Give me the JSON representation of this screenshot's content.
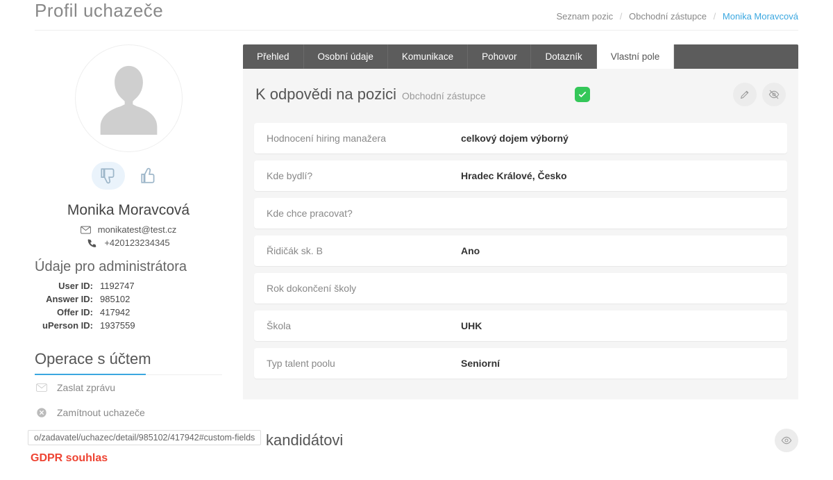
{
  "header": {
    "title": "Profil uchazeče"
  },
  "breadcrumb": {
    "items": [
      {
        "label": "Seznam pozic",
        "active": false
      },
      {
        "label": "Obchodní zástupce",
        "active": false
      },
      {
        "label": "Monika Moravcová",
        "active": true
      }
    ]
  },
  "candidate": {
    "name": "Monika Moravcová",
    "email": "monikatest@test.cz",
    "phone": "+420123234345"
  },
  "admin": {
    "heading": "Údaje pro administrátora",
    "rows": [
      {
        "label": "User ID:",
        "value": "1192747"
      },
      {
        "label": "Answer ID:",
        "value": "985102"
      },
      {
        "label": "Offer ID:",
        "value": "417942"
      },
      {
        "label": "uPerson ID:",
        "value": "1937559"
      }
    ]
  },
  "operations": {
    "heading": "Operace s účtem",
    "items": [
      {
        "label": "Zaslat zprávu",
        "icon": "mail"
      },
      {
        "label": "Zamítnout uchazeče",
        "icon": "reject"
      }
    ]
  },
  "tabs": [
    {
      "label": "Přehled",
      "active": false
    },
    {
      "label": "Osobní údaje",
      "active": false
    },
    {
      "label": "Komunikace",
      "active": false
    },
    {
      "label": "Pohovor",
      "active": false
    },
    {
      "label": "Dotazník",
      "active": false
    },
    {
      "label": "Vlastní pole",
      "active": true
    }
  ],
  "answers": {
    "title": "K odpovědi na pozici",
    "subtitle": "Obchodní zástupce",
    "fields": [
      {
        "label": "Hodnocení hiring manažera",
        "value": "celkový dojem výborný"
      },
      {
        "label": "Kde bydlí?",
        "value": "Hradec Králové, Česko"
      },
      {
        "label": "Kde chce pracovat?",
        "value": ""
      },
      {
        "label": "Řidičák sk. B",
        "value": "Ano"
      },
      {
        "label": "Rok dokončení školy",
        "value": ""
      },
      {
        "label": "Škola",
        "value": "UHK"
      },
      {
        "label": "Typ talent poolu",
        "value": "Seniorní"
      }
    ]
  },
  "lower": {
    "title": "Ke kandidátovi"
  },
  "statusbar": {
    "text": "o/zadavatel/uchazec/detail/985102/417942#custom-fields"
  },
  "gdpr": {
    "label": "GDPR souhlas"
  }
}
